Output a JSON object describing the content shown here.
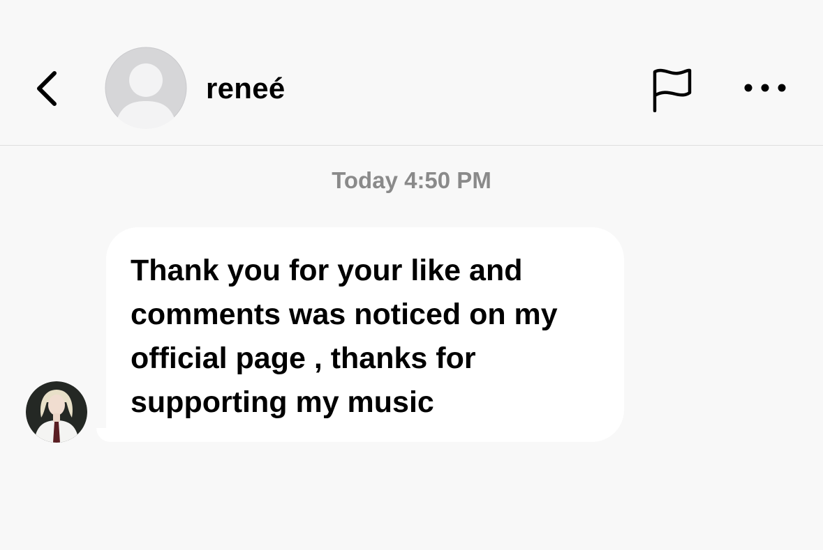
{
  "header": {
    "username": "reneé",
    "back_icon": "chevron-left-icon",
    "flag_icon": "flag-icon",
    "more_icon": "more-horizontal-icon",
    "avatar_icon": "default-avatar-icon"
  },
  "conversation": {
    "timestamp": "Today 4:50 PM",
    "messages": [
      {
        "sender": "reneé",
        "text": "Thank you for your like and\ncomments was noticed on my\nofficial page , thanks for\nsupporting my music"
      }
    ]
  },
  "colors": {
    "background": "#f8f8f8",
    "bubble": "#ffffff",
    "timestamp": "#8a8a8a",
    "divider": "#dedede",
    "default_avatar": "#d6d6d8"
  }
}
